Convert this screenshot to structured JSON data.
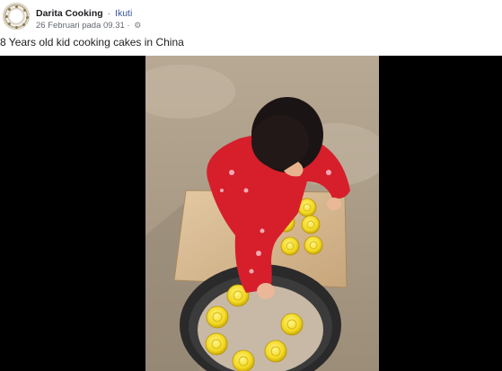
{
  "post": {
    "page_name": "Darita Cooking",
    "separator": "·",
    "follow_label": "Ikuti",
    "timestamp": "26 Februari pada 09.31 ·",
    "audience_icon": "globe-gear-icon",
    "caption": "8 Years old kid cooking cakes in China"
  },
  "video": {
    "description_icon": "video-frame"
  },
  "colors": {
    "link": "#385898",
    "text": "#1c1e21",
    "meta": "#616770",
    "video_bg": "#000000"
  }
}
